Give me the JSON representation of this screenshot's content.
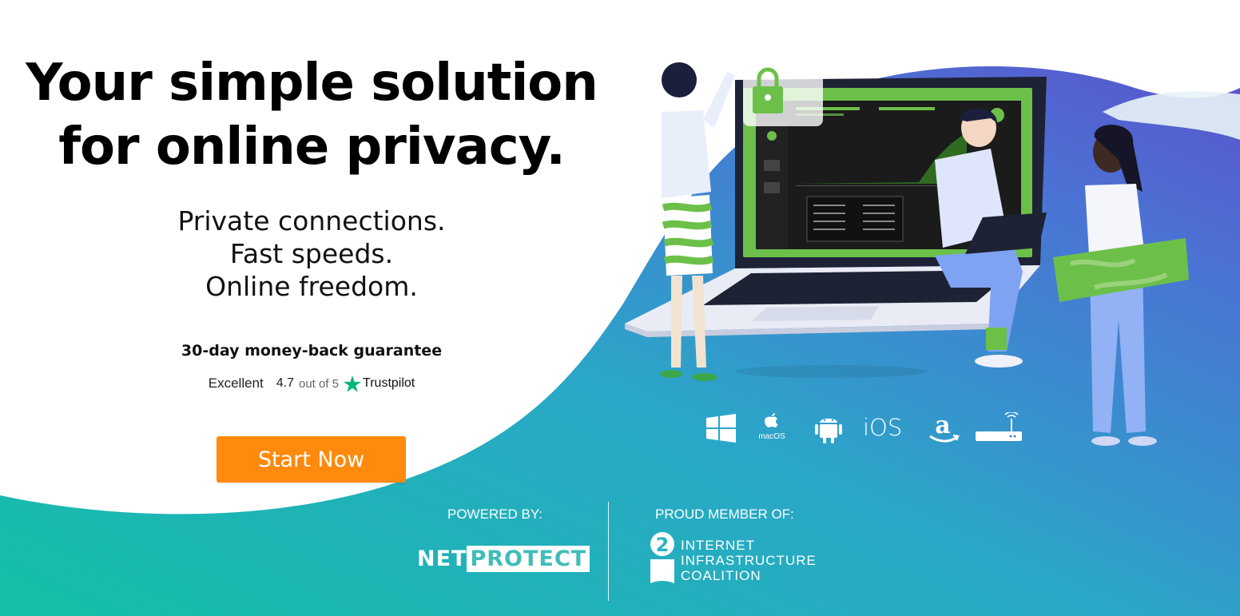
{
  "hero": {
    "title_line1": "Your simple solution",
    "title_line2": "for online privacy.",
    "tagline1": "Private connections.",
    "tagline2": "Fast speeds.",
    "tagline3": "Online freedom."
  },
  "guarantee": "30-day money-back guarantee",
  "rating": {
    "label": "Excellent",
    "score": "4.7",
    "out_of": "out of 5",
    "provider": "Trustpilot",
    "star_color": "#00b67a"
  },
  "cta": {
    "label": "Start Now",
    "color": "#ff8a0d"
  },
  "platforms": {
    "icons": [
      "windows-icon",
      "apple-icon",
      "android-icon",
      "ios-label",
      "amazon-icon",
      "router-icon"
    ],
    "macos_label": "macOS",
    "ios_label": "iOS"
  },
  "footer": {
    "powered_by": "POWERED BY:",
    "netprotect_a": "NET",
    "netprotect_b": "PROTECT",
    "member_of": "PROUD MEMBER OF:",
    "iic_line1": "INTERNET",
    "iic_line2": "INFRASTRUCTURE",
    "iic_line3": "COALITION"
  },
  "colors": {
    "gradient_start": "#1fbfae",
    "gradient_end": "#5a55cf",
    "vpn_green": "#6cc04a"
  }
}
